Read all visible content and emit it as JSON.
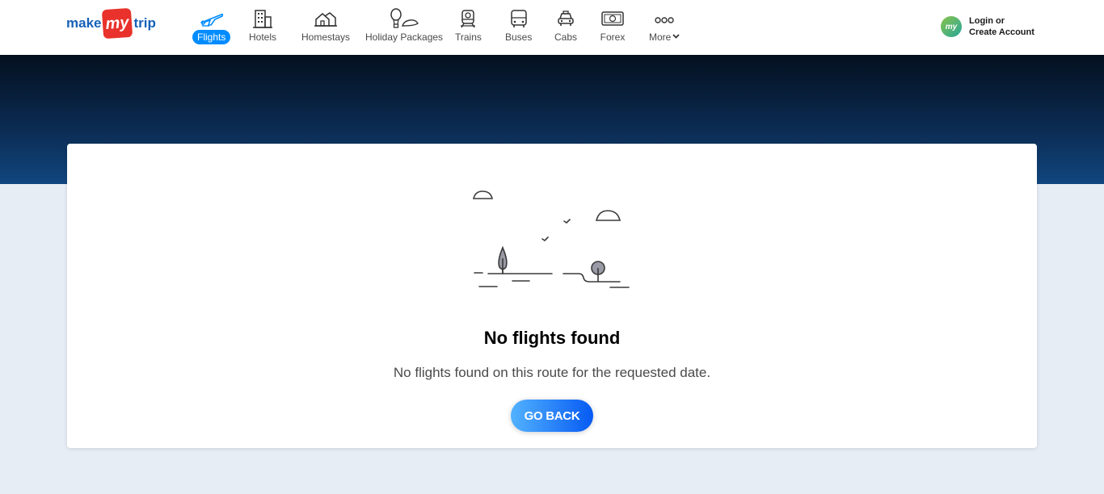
{
  "brand": {
    "logo_text": "makemytrip",
    "logo_part1": "make",
    "logo_part2": "my",
    "logo_part3": "trip",
    "colors": {
      "primary_blue": "#008cff",
      "brand_red": "#e8322b",
      "logo_blue": "#1561b8"
    }
  },
  "nav": {
    "items": [
      {
        "label": "Flights",
        "icon": "plane-icon",
        "active": true
      },
      {
        "label": "Hotels",
        "icon": "hotel-building-icon",
        "active": false
      },
      {
        "label": "Homestays",
        "icon": "house-icon",
        "active": false
      },
      {
        "label": "Holiday Packages",
        "icon": "balloon-island-icon",
        "active": false
      },
      {
        "label": "Trains",
        "icon": "train-icon",
        "active": false
      },
      {
        "label": "Buses",
        "icon": "bus-icon",
        "active": false
      },
      {
        "label": "Cabs",
        "icon": "taxi-icon",
        "active": false
      },
      {
        "label": "Forex",
        "icon": "currency-note-icon",
        "active": false
      },
      {
        "label": "More",
        "icon": "more-dots-icon",
        "active": false
      }
    ]
  },
  "account": {
    "line1": "Login or",
    "line2": "Create Account",
    "avatar_text": "my"
  },
  "result": {
    "title": "No flights found",
    "message": "No flights found on this route for the requested date.",
    "button_label": "GO BACK"
  }
}
